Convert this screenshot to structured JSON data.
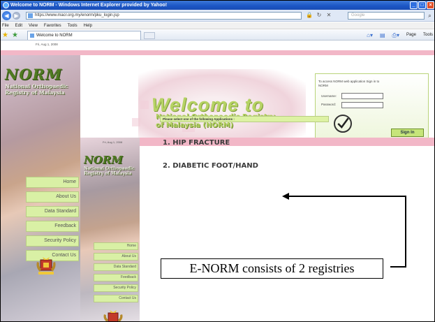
{
  "browser": {
    "title": "Welcome to NORM - Windows Internet Explorer provided by Yahoo!",
    "url": "https://www.macr.org.my/enorm/pku_login.jsp",
    "search_placeholder": "Google",
    "menu": [
      "File",
      "Edit",
      "View",
      "Favorites",
      "Tools",
      "Help"
    ],
    "tab_title": "Welcome to NORM",
    "command_bar": [
      "Page",
      "Tools"
    ]
  },
  "back_page": {
    "date": "Fri, Aug 1, 2008",
    "logo": {
      "name": "NORM",
      "sub": [
        "National Orthopaedic",
        "Registry of Malaysia"
      ]
    },
    "nav": [
      "Home",
      "About Us",
      "Data Standard",
      "Feedback",
      "Security Policy",
      "Contact Us"
    ],
    "welcome": {
      "title": "Welcome to",
      "line1": "National Orthopaedic Registry",
      "line2": "of Malaysia (NORM)"
    },
    "login": {
      "note": "To access NORM web application Sign in to NORM",
      "username_label": "Username:",
      "password_label": "Password:",
      "signin_label": "Sign In"
    }
  },
  "front_page": {
    "date": "Fri, Aug 1, 2008",
    "logo": {
      "name": "NORM",
      "sub": [
        "National Orthopaedic",
        "Registry of Malaysia"
      ]
    },
    "nav": [
      "Home",
      "About Us",
      "Data Standard",
      "Feedback",
      "Security Policy",
      "Contact Us"
    ],
    "select_prompt": "Please select one of the following Applications :",
    "apps": [
      "1. HIP FRACTURE",
      "2. DIABETIC FOOT/HAND"
    ]
  },
  "callout": "E-NORM consists of 2 registries",
  "colors": {
    "accent_pink": "#f2b7c7",
    "accent_green": "#d9f0a5",
    "logo_green": "#4f7a21"
  }
}
